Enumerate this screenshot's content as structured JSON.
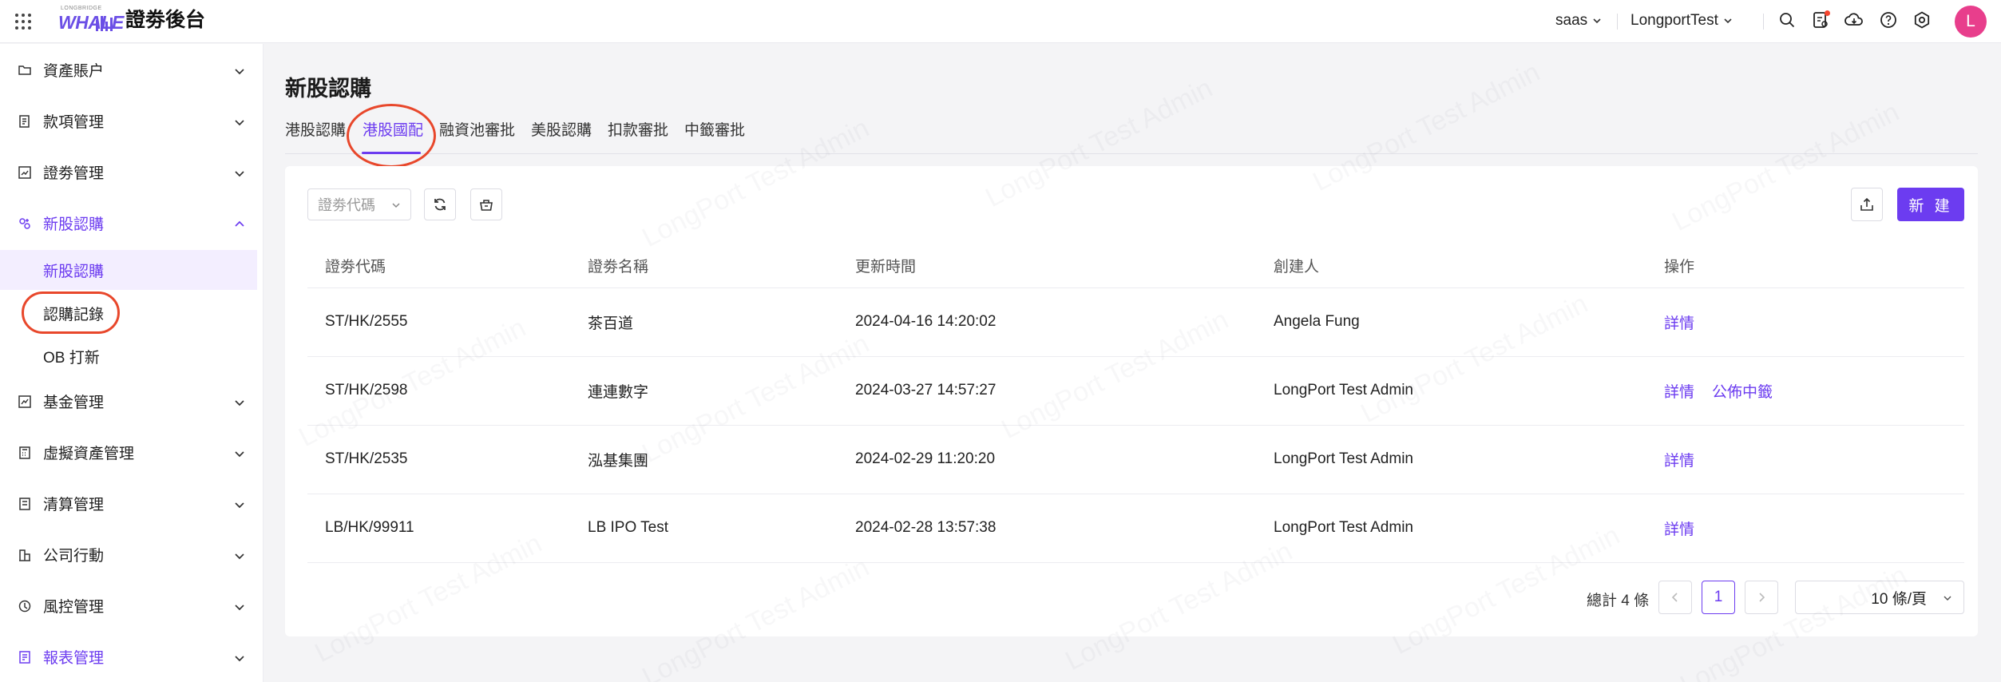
{
  "app": {
    "title": "證劵後台",
    "logo_text": "WHALE",
    "logo_small": "LONGBRIDGE"
  },
  "topbar": {
    "tenant": "saas",
    "account": "LongportTest",
    "avatar": "L",
    "icons": [
      "search-icon",
      "notification-icon",
      "download-icon",
      "help-icon",
      "settings-icon"
    ]
  },
  "sidebar": {
    "items": [
      {
        "label": "資產賬户",
        "icon": "folder-icon"
      },
      {
        "label": "款項管理",
        "icon": "ledger-icon"
      },
      {
        "label": "證劵管理",
        "icon": "chart-icon"
      },
      {
        "label": "新股認購",
        "icon": "ipo-icon"
      },
      {
        "label": "基金管理",
        "icon": "fund-icon"
      },
      {
        "label": "虛擬資產管理",
        "icon": "calculator-icon"
      },
      {
        "label": "清算管理",
        "icon": "clearing-icon"
      },
      {
        "label": "公司行動",
        "icon": "company-icon"
      },
      {
        "label": "風控管理",
        "icon": "risk-icon"
      },
      {
        "label": "報表管理",
        "icon": "report-icon"
      }
    ],
    "sub_items": [
      "新股認購",
      "認購記錄",
      "OB 打新"
    ]
  },
  "page": {
    "title": "新股認購"
  },
  "tabs": [
    "港股認購",
    "港股國配",
    "融資池審批",
    "美股認購",
    "扣款審批",
    "中籤審批"
  ],
  "toolbar": {
    "filter_placeholder": "證劵代碼",
    "new_label": "新 建"
  },
  "table": {
    "headers": [
      "證劵代碼",
      "證劵名稱",
      "更新時間",
      "創建人",
      "操作"
    ],
    "rows": [
      {
        "code": "ST/HK/2555",
        "name": "茶百道",
        "time": "2024-04-16 14:20:02",
        "creator": "Angela Fung",
        "actions": [
          "詳情"
        ]
      },
      {
        "code": "ST/HK/2598",
        "name": "連連數字",
        "time": "2024-03-27 14:57:27",
        "creator": "LongPort Test Admin",
        "actions": [
          "詳情",
          "公佈中籤"
        ]
      },
      {
        "code": "ST/HK/2535",
        "name": "泓基集團",
        "time": "2024-02-29 11:20:20",
        "creator": "LongPort Test Admin",
        "actions": [
          "詳情"
        ]
      },
      {
        "code": "LB/HK/99911",
        "name": "LB IPO Test",
        "time": "2024-02-28 13:57:38",
        "creator": "LongPort Test Admin",
        "actions": [
          "詳情"
        ]
      }
    ]
  },
  "pagination": {
    "total": "總計 4 條",
    "current": "1",
    "page_size": "10 條/頁"
  },
  "watermark": "LongPort Test Admin",
  "colors": {
    "accent": "#6c3cf0",
    "highlight": "#e8472b",
    "avatar": "#e83e8c"
  }
}
